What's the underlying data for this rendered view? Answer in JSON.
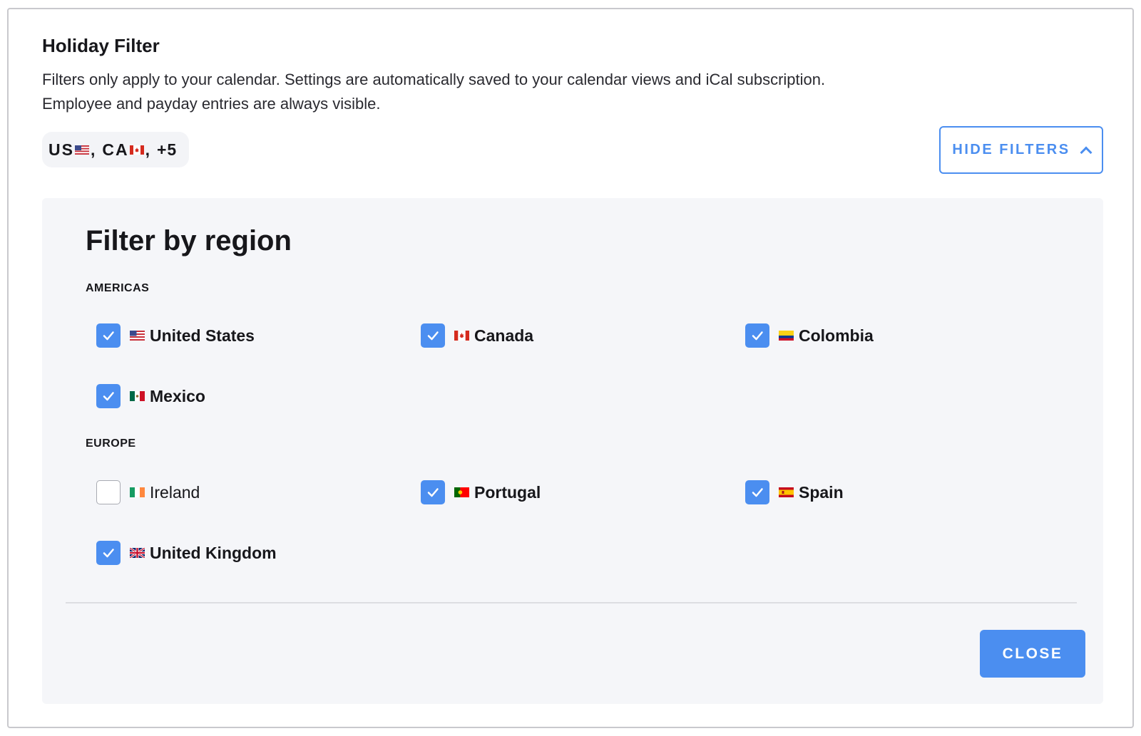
{
  "header": {
    "title": "Holiday Filter",
    "description_line1": "Filters only apply to your calendar. Settings are automatically saved to your calendar views and iCal subscription.",
    "description_line2": "Employee and payday entries are always visible."
  },
  "summary_chip": {
    "code_1": "US",
    "separator_1": ",",
    "code_2": "CA",
    "separator_2": ",",
    "more": "+5",
    "flag_1": "us-flag-icon",
    "flag_2": "canada-flag-icon"
  },
  "hide_filters": {
    "label": "HIDE FILTERS",
    "icon": "chevron-up-icon",
    "color": "#4b8ef0"
  },
  "filter_panel": {
    "title": "Filter by region",
    "groups": [
      {
        "label": "AMERICAS",
        "items": [
          {
            "label": "United States",
            "checked": true,
            "flag": "us-flag-icon"
          },
          {
            "label": "Canada",
            "checked": true,
            "flag": "canada-flag-icon"
          },
          {
            "label": "Colombia",
            "checked": true,
            "flag": "colombia-flag-icon"
          },
          {
            "label": "Mexico",
            "checked": true,
            "flag": "mexico-flag-icon"
          }
        ]
      },
      {
        "label": "EUROPE",
        "items": [
          {
            "label": "Ireland",
            "checked": false,
            "flag": "ireland-flag-icon"
          },
          {
            "label": "Portugal",
            "checked": true,
            "flag": "portugal-flag-icon"
          },
          {
            "label": "Spain",
            "checked": true,
            "flag": "spain-flag-icon"
          },
          {
            "label": "United Kingdom",
            "checked": true,
            "flag": "uk-flag-icon"
          }
        ]
      }
    ]
  },
  "footer": {
    "close_label": "CLOSE",
    "accent_color": "#4b8ef0"
  }
}
